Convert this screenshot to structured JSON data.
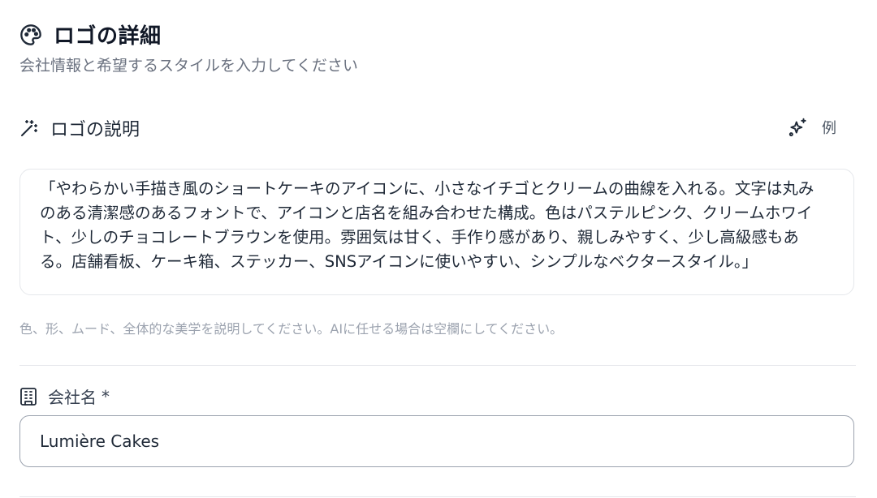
{
  "header": {
    "title": "ロゴの詳細",
    "subtitle": "会社情報と希望するスタイルを入力してください",
    "icon": "palette-icon"
  },
  "description": {
    "label": "ロゴの説明",
    "icon": "magic-wand-icon",
    "example_label": "例",
    "example_icon": "sparkles-icon",
    "value": "「やわらかい手描き風のショートケーキのアイコンに、小さなイチゴとクリームの曲線を入れる。文字は丸みのある清潔感のあるフォントで、アイコンと店名を組み合わせた構成。色はパステルピンク、クリームホワイト、少しのチョコレートブラウンを使用。雰囲気は甘く、手作り感があり、親しみやすく、少し高級感もある。店舗看板、ケーキ箱、ステッカー、SNSアイコンに使いやすい、シンプルなベクタースタイル。」",
    "helper": "色、形、ムード、全体的な美学を説明してください。AIに任せる場合は空欄にしてください。"
  },
  "company": {
    "label": "会社名",
    "required_mark": "*",
    "icon": "building-icon",
    "value": "Lumière Cakes"
  },
  "colors": {
    "text": "#1f2937",
    "muted": "#6b7280",
    "border": "#e5e7eb",
    "input_border": "#9ca3af"
  }
}
